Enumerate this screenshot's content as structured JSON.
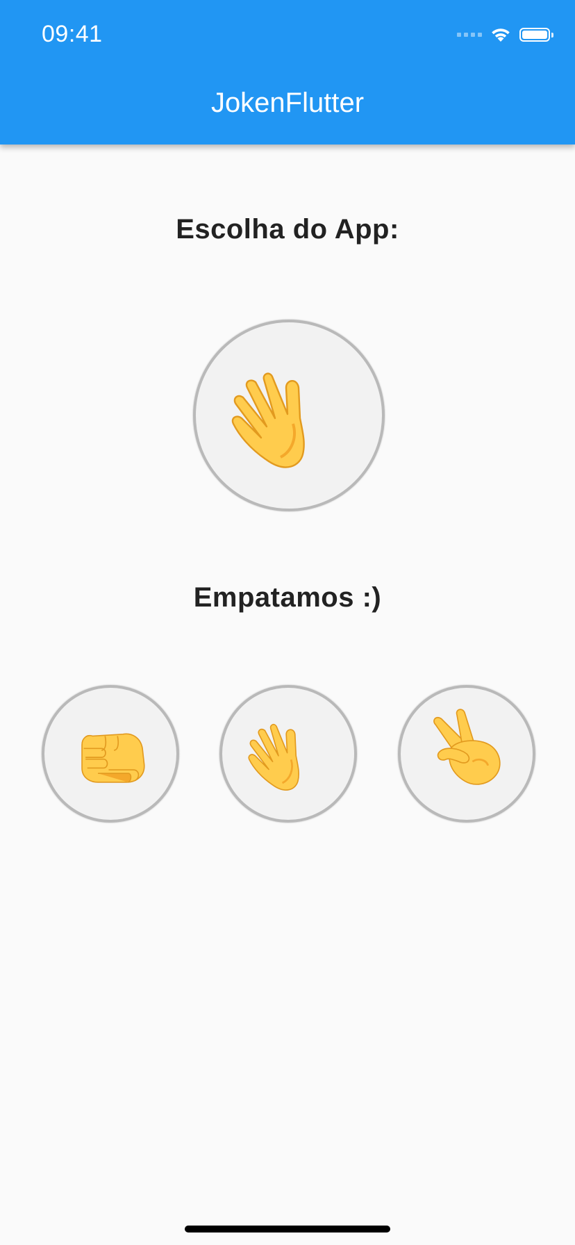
{
  "status_bar": {
    "time": "09:41"
  },
  "app_bar": {
    "title": "JokenFlutter",
    "color": "#2196f3"
  },
  "main": {
    "app_choice_label": "Escolha do App:",
    "app_choice_icon": "waving-hand-icon",
    "result_text": "Empatamos :)",
    "options": [
      {
        "name": "rock",
        "icon": "fist-icon"
      },
      {
        "name": "paper",
        "icon": "waving-hand-icon"
      },
      {
        "name": "scissors",
        "icon": "victory-hand-icon"
      }
    ]
  },
  "colors": {
    "emoji_yellow": "#ffcc4d",
    "emoji_shade": "#f4a82b",
    "background": "#fafafa"
  }
}
